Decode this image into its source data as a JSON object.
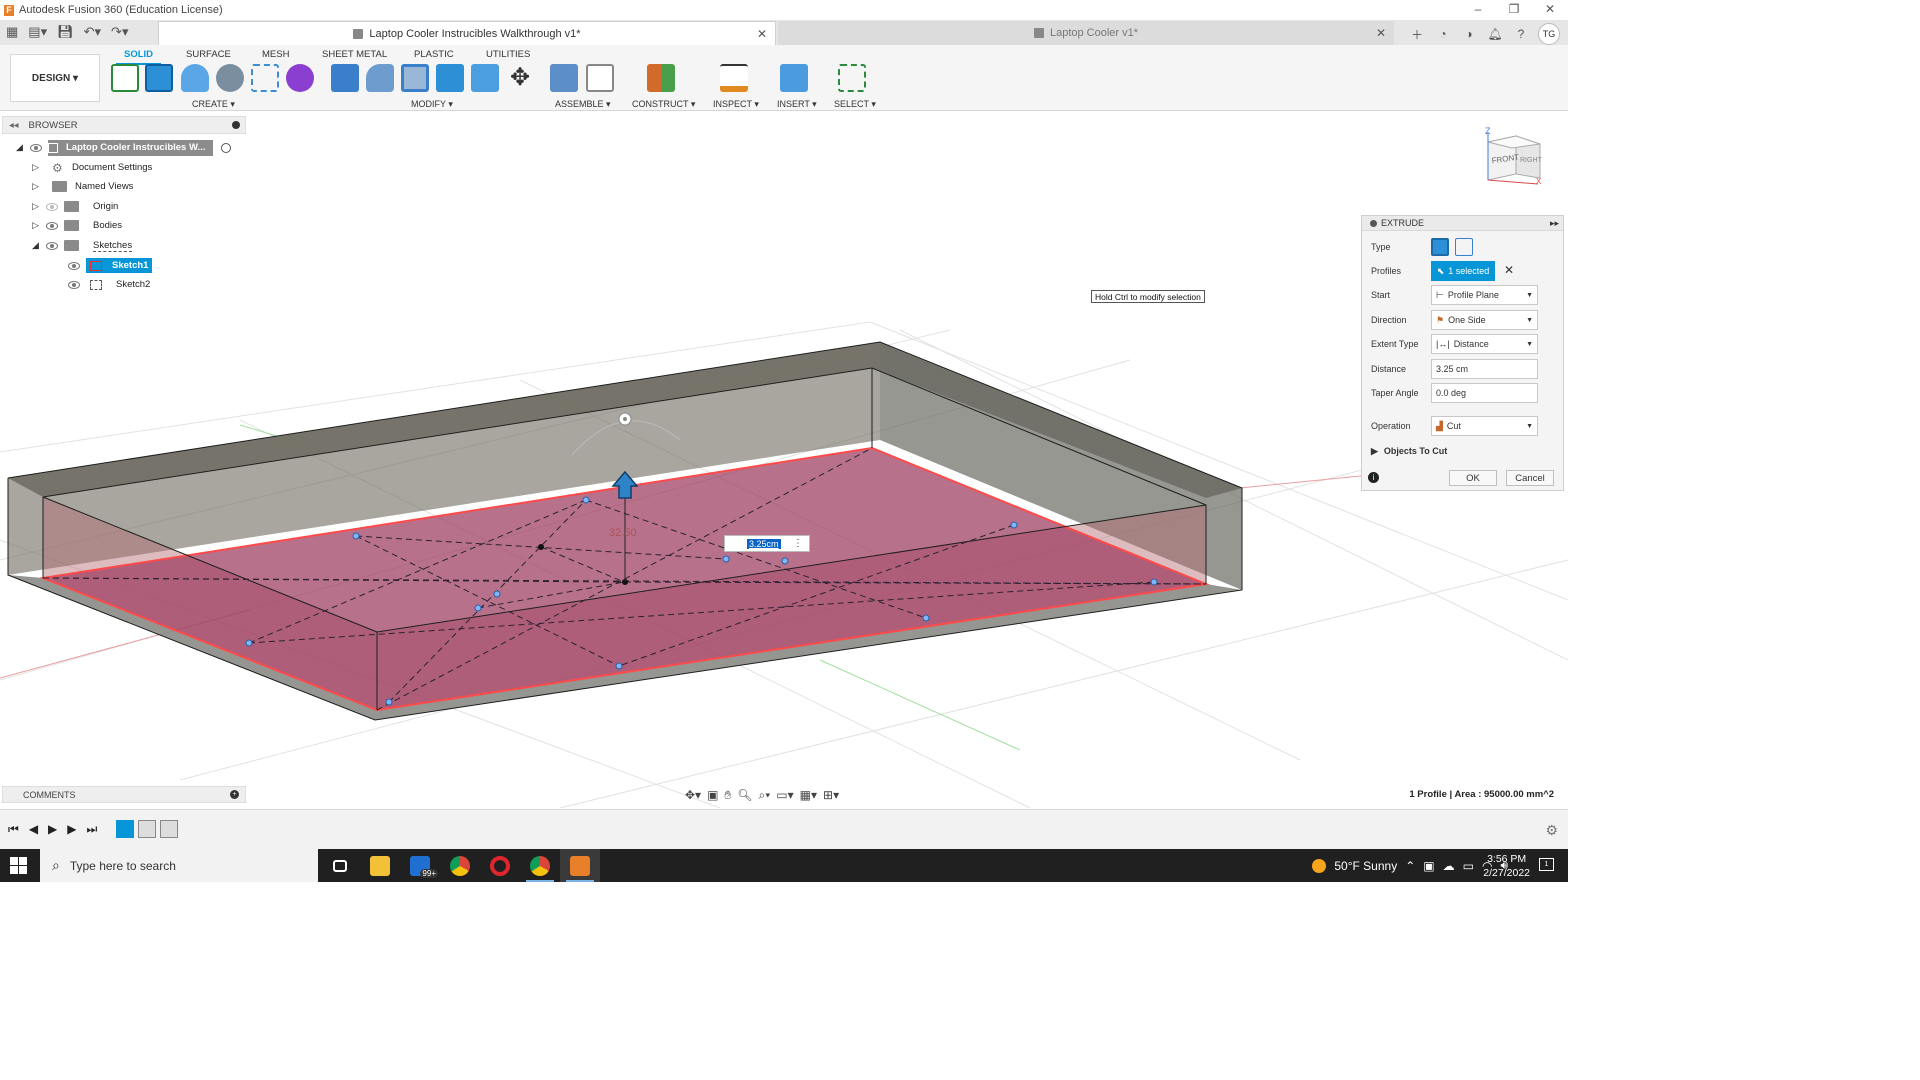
{
  "window": {
    "app_title": "Autodesk Fusion 360 (Education License)",
    "app_logo": "F",
    "controls": [
      "–",
      "❐",
      "✕"
    ]
  },
  "tabs": [
    {
      "label": "Laptop Cooler Instrucibles Walkthrough v1*",
      "active": true
    },
    {
      "label": "Laptop Cooler v1*",
      "active": false
    }
  ],
  "user_initials": "TG",
  "ribbon": {
    "workspace": "DESIGN ▾",
    "tabs": [
      "SOLID",
      "SURFACE",
      "MESH",
      "SHEET METAL",
      "PLASTIC",
      "UTILITIES"
    ],
    "groups": [
      "CREATE ▾",
      "MODIFY ▾",
      "ASSEMBLE ▾",
      "CONSTRUCT ▾",
      "INSPECT ▾",
      "INSERT ▾",
      "SELECT ▾"
    ]
  },
  "browser": {
    "title": "BROWSER",
    "root": "Laptop Cooler Instrucibles W...",
    "items": [
      {
        "label": "Document Settings",
        "icon": "gear-icon"
      },
      {
        "label": "Named Views",
        "icon": "folder-icon"
      },
      {
        "label": "Origin",
        "icon": "folder-icon"
      },
      {
        "label": "Bodies",
        "icon": "folder-icon"
      },
      {
        "label": "Sketches",
        "icon": "folder-icon"
      }
    ],
    "sketches": [
      {
        "label": "Sketch1",
        "selected": true
      },
      {
        "label": "Sketch2",
        "selected": false
      }
    ]
  },
  "tooltip": "Hold Ctrl to modify selection",
  "extrude": {
    "title": "EXTRUDE",
    "type_label": "Type",
    "profiles_label": "Profiles",
    "profiles_value": "1 selected",
    "start_label": "Start",
    "start_value": "Profile Plane",
    "direction_label": "Direction",
    "direction_value": "One Side",
    "extent_label": "Extent Type",
    "extent_value": "Distance",
    "distance_label": "Distance",
    "distance_value": "3.25 cm",
    "taper_label": "Taper Angle",
    "taper_value": "0.0 deg",
    "operation_label": "Operation",
    "operation_value": "Cut",
    "objects_label": "Objects To Cut",
    "ok_label": "OK",
    "cancel_label": "Cancel"
  },
  "viewcube": {
    "front": "FRONT",
    "right": "RIGHT",
    "z": "Z",
    "x": "X"
  },
  "viewport": {
    "dimension_text": "32.50",
    "input_value": "3.25cm"
  },
  "comments": {
    "title": "COMMENTS"
  },
  "status": "1 Profile | Area : 95000.00 mm^2",
  "taskbar": {
    "search_placeholder": "Type here to search",
    "mail_badge": "99+",
    "weather": "50°F  Sunny",
    "time": "3:56 PM",
    "date": "2/27/2022",
    "notify_count": "1"
  },
  "colors": {
    "accent": "#0696d7",
    "profile_fill": "#9c3a5e",
    "body_gray": "#6d6d66"
  }
}
